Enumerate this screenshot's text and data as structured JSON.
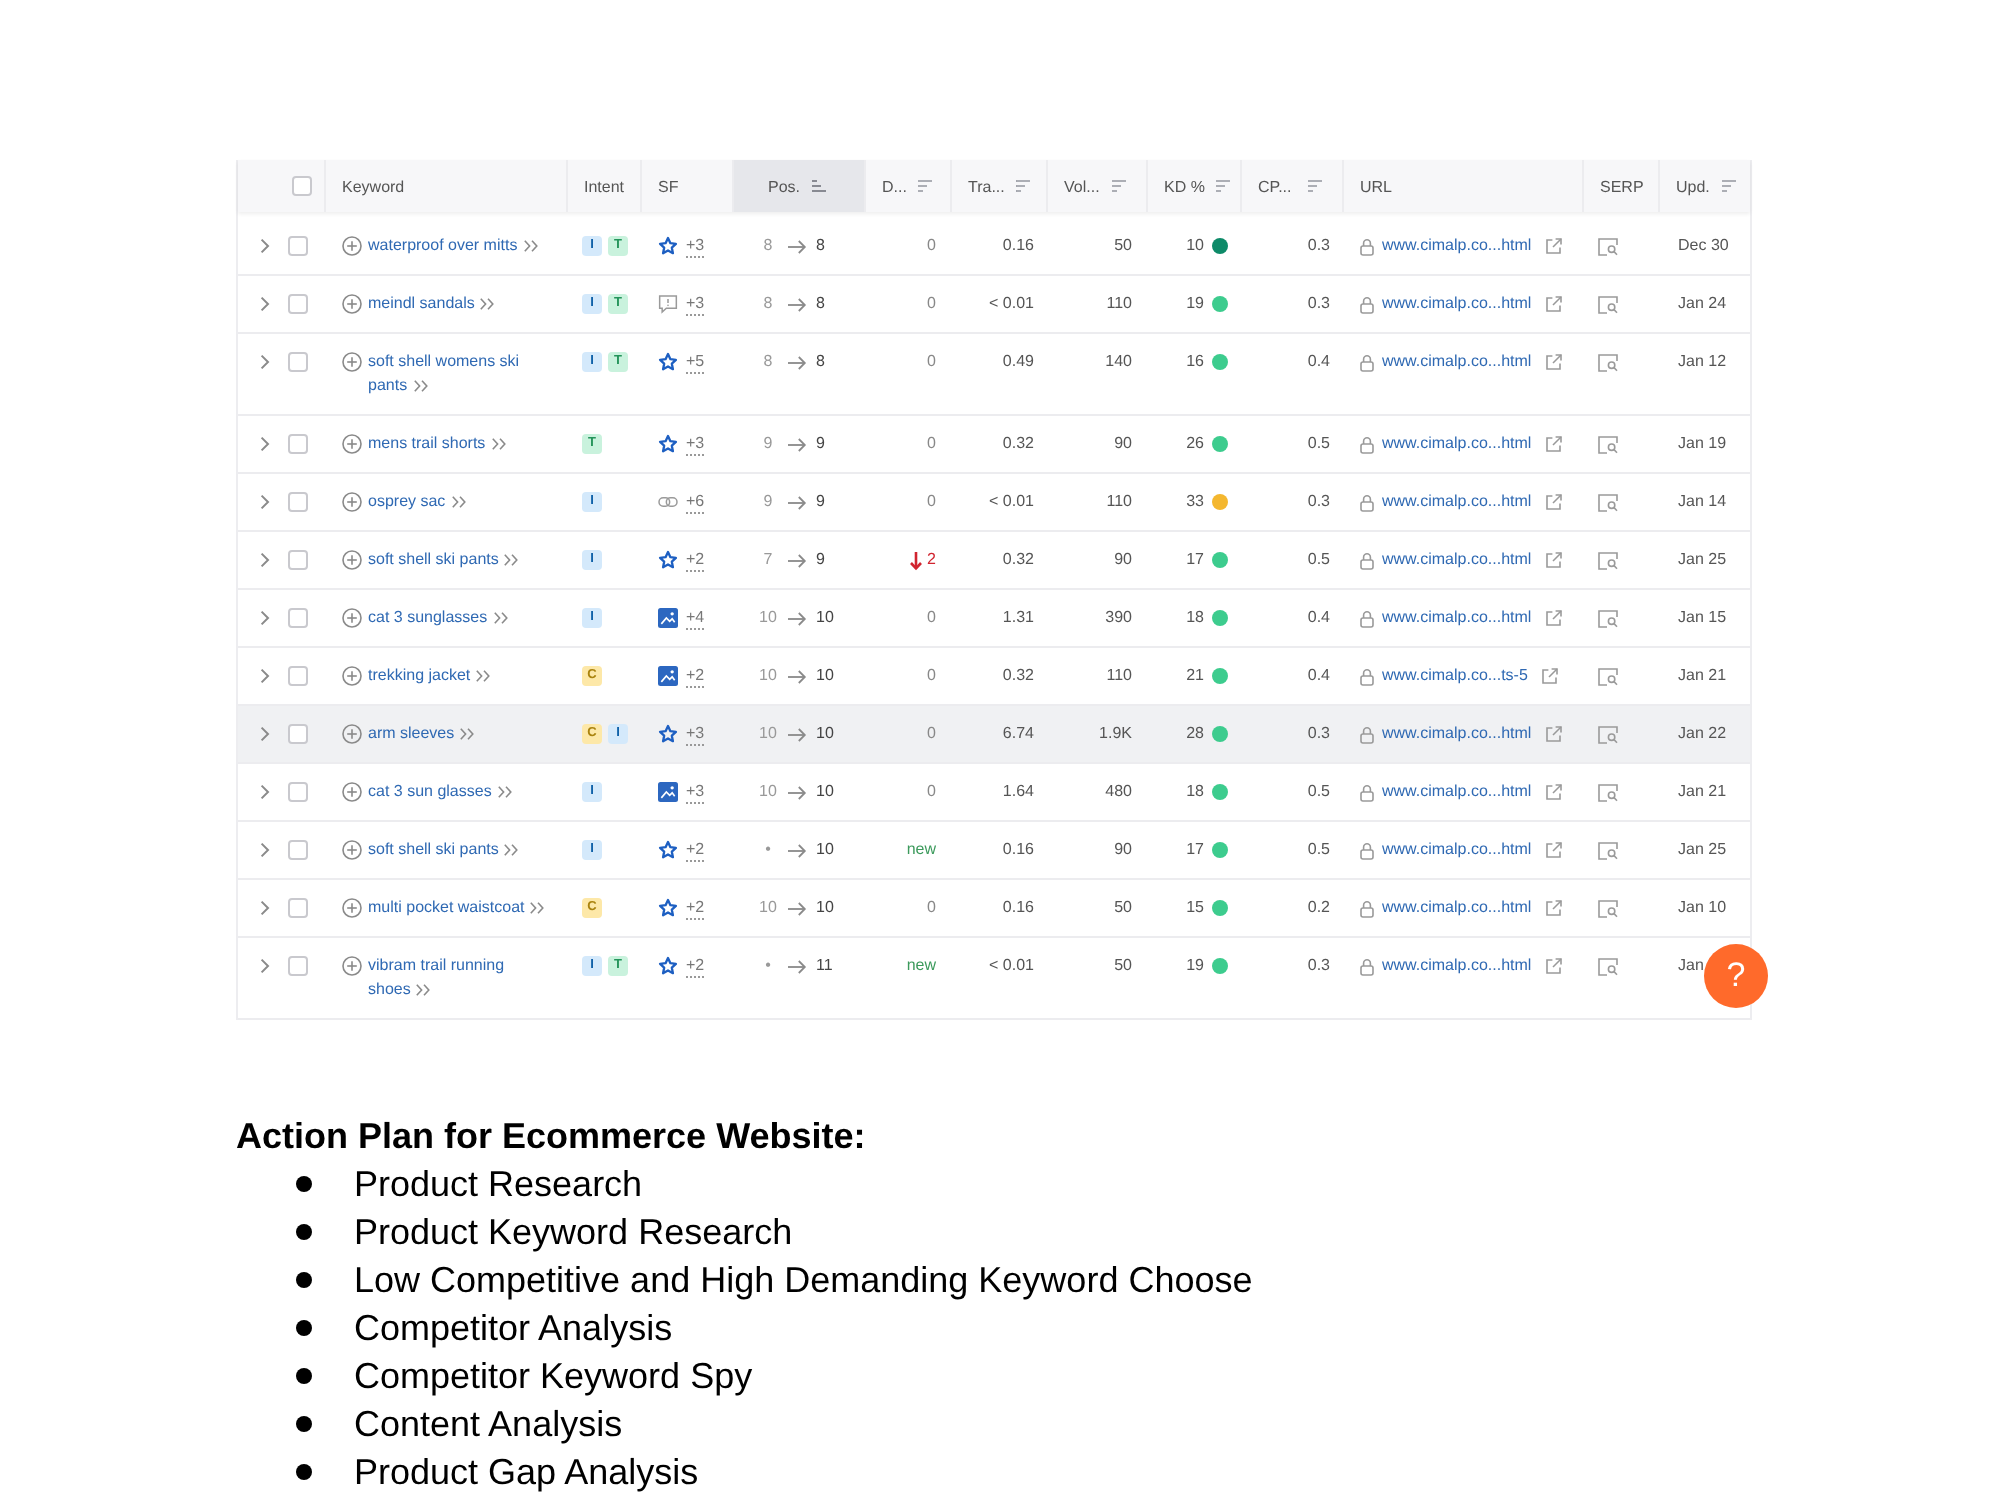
{
  "table": {
    "header_checkbox": {
      "checked": false
    },
    "columns": [
      {
        "label": "Keyword",
        "sortable": false,
        "sorted": false
      },
      {
        "label": "Intent",
        "sortable": false,
        "sorted": false
      },
      {
        "label": "SF",
        "sortable": false,
        "sorted": false
      },
      {
        "label": "Pos.",
        "sortable": true,
        "sorted": true
      },
      {
        "label": "D...",
        "sortable": true,
        "sorted": false
      },
      {
        "label": "Tra...",
        "sortable": true,
        "sorted": false
      },
      {
        "label": "Vol...",
        "sortable": true,
        "sorted": false
      },
      {
        "label": "KD %",
        "sortable": true,
        "sorted": false
      },
      {
        "label": "CP...",
        "sortable": true,
        "sorted": false
      },
      {
        "label": "URL",
        "sortable": false,
        "sorted": false
      },
      {
        "label": "SERP",
        "sortable": false,
        "sorted": false
      },
      {
        "label": "Upd.",
        "sortable": true,
        "sorted": false
      }
    ],
    "rows": [
      {
        "expanded": false,
        "checked": false,
        "highlighted": false,
        "keyword": "waterproof over mitts",
        "intents": [
          {
            "label": "I",
            "color": "#d4e9fb"
          },
          {
            "label": "T",
            "color": "#c9f2dd"
          }
        ],
        "sf": {
          "kind": "star",
          "count": "+3"
        },
        "pos_from": "8",
        "pos_to": "8",
        "diff": {
          "kind": "none",
          "text": "0"
        },
        "traffic": "0.16",
        "volume": "50",
        "kd": {
          "value": "10",
          "color": "#0d8a68"
        },
        "cpc": "0.3",
        "url": "www.cimalp.co...html",
        "updated": "Dec 30"
      },
      {
        "expanded": false,
        "checked": false,
        "highlighted": false,
        "keyword": "meindl sandals",
        "intents": [
          {
            "label": "I",
            "color": "#d4e9fb"
          },
          {
            "label": "T",
            "color": "#c9f2dd"
          }
        ],
        "sf": {
          "kind": "comment",
          "count": "+3"
        },
        "pos_from": "8",
        "pos_to": "8",
        "diff": {
          "kind": "none",
          "text": "0"
        },
        "traffic": "< 0.01",
        "volume": "110",
        "kd": {
          "value": "19",
          "color": "#3dcc8e"
        },
        "cpc": "0.3",
        "url": "www.cimalp.co...html",
        "updated": "Jan 24"
      },
      {
        "expanded": false,
        "checked": false,
        "highlighted": false,
        "keyword": "soft shell womens ski pants",
        "intents": [
          {
            "label": "I",
            "color": "#d4e9fb"
          },
          {
            "label": "T",
            "color": "#c9f2dd"
          }
        ],
        "sf": {
          "kind": "star",
          "count": "+5"
        },
        "pos_from": "8",
        "pos_to": "8",
        "diff": {
          "kind": "none",
          "text": "0"
        },
        "traffic": "0.49",
        "volume": "140",
        "kd": {
          "value": "16",
          "color": "#3dcc8e"
        },
        "cpc": "0.4",
        "url": "www.cimalp.co...html",
        "updated": "Jan 12"
      },
      {
        "expanded": false,
        "checked": false,
        "highlighted": false,
        "keyword": "mens trail shorts",
        "intents": [
          {
            "label": "T",
            "color": "#c9f2dd"
          }
        ],
        "sf": {
          "kind": "star",
          "count": "+3"
        },
        "pos_from": "9",
        "pos_to": "9",
        "diff": {
          "kind": "none",
          "text": "0"
        },
        "traffic": "0.32",
        "volume": "90",
        "kd": {
          "value": "26",
          "color": "#3dcc8e"
        },
        "cpc": "0.5",
        "url": "www.cimalp.co...html",
        "updated": "Jan 19"
      },
      {
        "expanded": false,
        "checked": false,
        "highlighted": false,
        "keyword": "osprey sac",
        "intents": [
          {
            "label": "I",
            "color": "#d4e9fb"
          }
        ],
        "sf": {
          "kind": "link",
          "count": "+6"
        },
        "pos_from": "9",
        "pos_to": "9",
        "diff": {
          "kind": "none",
          "text": "0"
        },
        "traffic": "< 0.01",
        "volume": "110",
        "kd": {
          "value": "33",
          "color": "#f4b72f"
        },
        "cpc": "0.3",
        "url": "www.cimalp.co...html",
        "updated": "Jan 14"
      },
      {
        "expanded": false,
        "checked": false,
        "highlighted": false,
        "keyword": "soft shell ski pants",
        "intents": [
          {
            "label": "I",
            "color": "#d4e9fb"
          }
        ],
        "sf": {
          "kind": "star",
          "count": "+2"
        },
        "pos_from": "7",
        "pos_to": "9",
        "diff": {
          "kind": "down",
          "text": "2"
        },
        "traffic": "0.32",
        "volume": "90",
        "kd": {
          "value": "17",
          "color": "#3dcc8e"
        },
        "cpc": "0.5",
        "url": "www.cimalp.co...html",
        "updated": "Jan 25"
      },
      {
        "expanded": false,
        "checked": false,
        "highlighted": false,
        "keyword": "cat 3 sunglasses",
        "intents": [
          {
            "label": "I",
            "color": "#d4e9fb"
          }
        ],
        "sf": {
          "kind": "image",
          "count": "+4"
        },
        "pos_from": "10",
        "pos_to": "10",
        "diff": {
          "kind": "none",
          "text": "0"
        },
        "traffic": "1.31",
        "volume": "390",
        "kd": {
          "value": "18",
          "color": "#3dcc8e"
        },
        "cpc": "0.4",
        "url": "www.cimalp.co...html",
        "updated": "Jan 15"
      },
      {
        "expanded": false,
        "checked": false,
        "highlighted": false,
        "keyword": "trekking jacket",
        "intents": [
          {
            "label": "C",
            "color": "#fde8a8"
          }
        ],
        "sf": {
          "kind": "image",
          "count": "+2"
        },
        "pos_from": "10",
        "pos_to": "10",
        "diff": {
          "kind": "none",
          "text": "0"
        },
        "traffic": "0.32",
        "volume": "110",
        "kd": {
          "value": "21",
          "color": "#3dcc8e"
        },
        "cpc": "0.4",
        "url": "www.cimalp.co...ts-5",
        "updated": "Jan 21"
      },
      {
        "expanded": false,
        "checked": false,
        "highlighted": true,
        "keyword": "arm sleeves",
        "intents": [
          {
            "label": "C",
            "color": "#fde8a8"
          },
          {
            "label": "I",
            "color": "#d4e9fb"
          }
        ],
        "sf": {
          "kind": "star",
          "count": "+3"
        },
        "pos_from": "10",
        "pos_to": "10",
        "diff": {
          "kind": "none",
          "text": "0"
        },
        "traffic": "6.74",
        "volume": "1.9K",
        "kd": {
          "value": "28",
          "color": "#3dcc8e"
        },
        "cpc": "0.3",
        "url": "www.cimalp.co...html",
        "updated": "Jan 22"
      },
      {
        "expanded": false,
        "checked": false,
        "highlighted": false,
        "keyword": "cat 3 sun glasses",
        "intents": [
          {
            "label": "I",
            "color": "#d4e9fb"
          }
        ],
        "sf": {
          "kind": "image",
          "count": "+3"
        },
        "pos_from": "10",
        "pos_to": "10",
        "diff": {
          "kind": "none",
          "text": "0"
        },
        "traffic": "1.64",
        "volume": "480",
        "kd": {
          "value": "18",
          "color": "#3dcc8e"
        },
        "cpc": "0.5",
        "url": "www.cimalp.co...html",
        "updated": "Jan 21"
      },
      {
        "expanded": false,
        "checked": false,
        "highlighted": false,
        "keyword": "soft shell ski pants",
        "intents": [
          {
            "label": "I",
            "color": "#d4e9fb"
          }
        ],
        "sf": {
          "kind": "star",
          "count": "+2"
        },
        "pos_from": "•",
        "pos_to": "10",
        "diff": {
          "kind": "new",
          "text": "new"
        },
        "traffic": "0.16",
        "volume": "90",
        "kd": {
          "value": "17",
          "color": "#3dcc8e"
        },
        "cpc": "0.5",
        "url": "www.cimalp.co...html",
        "updated": "Jan 25"
      },
      {
        "expanded": false,
        "checked": false,
        "highlighted": false,
        "keyword": "multi pocket waistcoat",
        "intents": [
          {
            "label": "C",
            "color": "#fde8a8"
          }
        ],
        "sf": {
          "kind": "star",
          "count": "+2"
        },
        "pos_from": "10",
        "pos_to": "10",
        "diff": {
          "kind": "none",
          "text": "0"
        },
        "traffic": "0.16",
        "volume": "50",
        "kd": {
          "value": "15",
          "color": "#3dcc8e"
        },
        "cpc": "0.2",
        "url": "www.cimalp.co...html",
        "updated": "Jan 10"
      },
      {
        "expanded": false,
        "checked": false,
        "highlighted": false,
        "keyword": "vibram trail running shoes",
        "intents": [
          {
            "label": "I",
            "color": "#d4e9fb"
          },
          {
            "label": "T",
            "color": "#c9f2dd"
          }
        ],
        "sf": {
          "kind": "star",
          "count": "+2"
        },
        "pos_from": "•",
        "pos_to": "11",
        "diff": {
          "kind": "new",
          "text": "new"
        },
        "traffic": "< 0.01",
        "volume": "50",
        "kd": {
          "value": "19",
          "color": "#3dcc8e"
        },
        "cpc": "0.3",
        "url": "www.cimalp.co...html",
        "updated": "Jan"
      }
    ]
  },
  "help_button": {
    "label": "?"
  },
  "action_plan": {
    "title": "Action Plan for Ecommerce Website:",
    "items": [
      "Product Research",
      "Product Keyword Research",
      "Low Competitive and High Demanding Keyword Choose",
      "Competitor Analysis",
      "Competitor Keyword Spy",
      "Content Analysis",
      "Product Gap Analysis"
    ]
  }
}
